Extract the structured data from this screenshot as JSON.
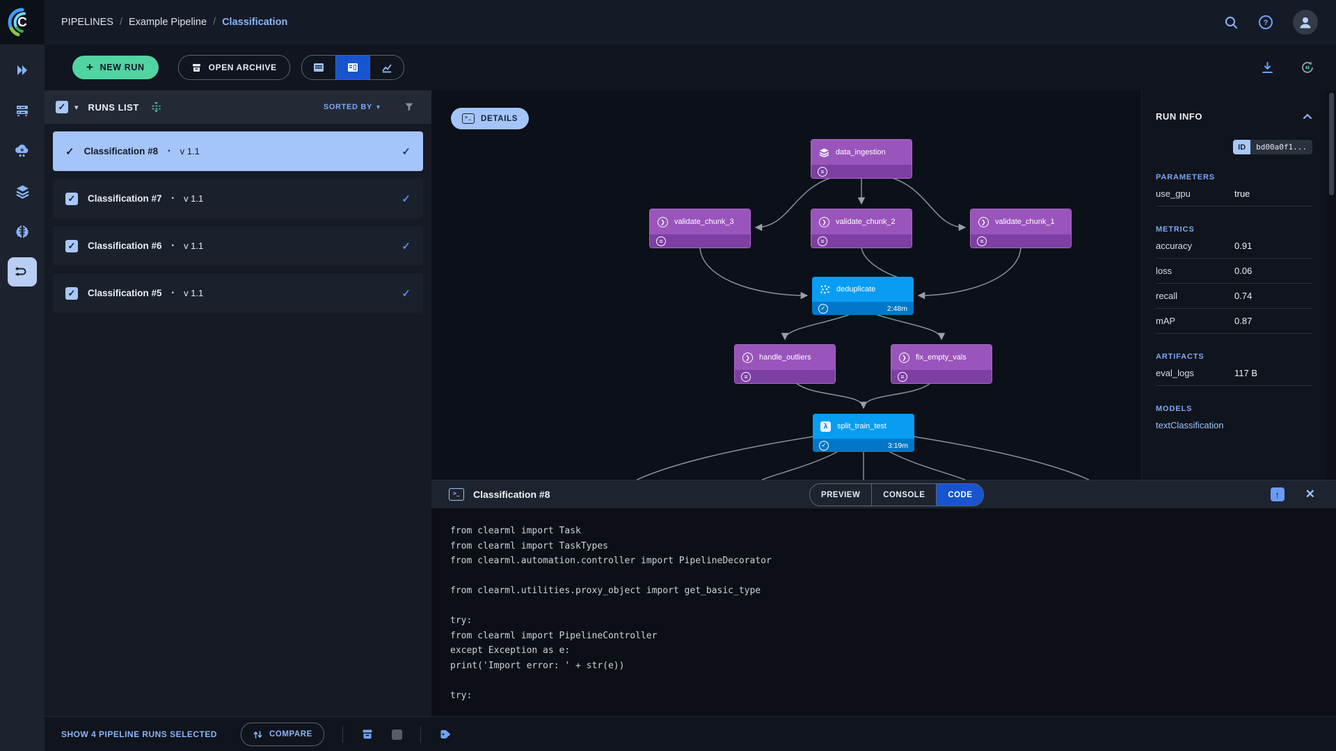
{
  "colors": {
    "accent_blue": "#1654d0",
    "light_blue": "#8ab4f8",
    "selection_bg": "#a5c4f9",
    "new_run_green": "#52d3a2",
    "node_purple": "#9a55bc",
    "node_purple_strip": "#7d3fa2",
    "node_blue": "#089df2",
    "node_blue_strip": "#0277c8"
  },
  "header": {
    "breadcrumb": {
      "root": "PIPELINES",
      "sep": "/",
      "project": "Example Pipeline",
      "current": "Classification"
    }
  },
  "toolbar": {
    "new_run_label": "NEW RUN",
    "open_archive_label": "OPEN ARCHIVE"
  },
  "runs_list": {
    "title": "RUNS LIST",
    "sorted_by_label": "SORTED BY",
    "items": [
      {
        "name": "Classification #8",
        "bullet": "•",
        "version": "v 1.1",
        "selected": true
      },
      {
        "name": "Classification #7",
        "bullet": "•",
        "version": "v 1.1",
        "selected": false
      },
      {
        "name": "Classification #6",
        "bullet": "•",
        "version": "v 1.1",
        "selected": false
      },
      {
        "name": "Classification #5",
        "bullet": "•",
        "version": "v 1.1",
        "selected": false
      }
    ],
    "check_glyph": "✓"
  },
  "dag": {
    "details_label": "DETAILS",
    "nodes": [
      {
        "label": "data_ingestion"
      },
      {
        "label": "validate_chunk_3"
      },
      {
        "label": "validate_chunk_2"
      },
      {
        "label": "validate_chunk_1"
      },
      {
        "label": "deduplicate",
        "duration": "2:48m"
      },
      {
        "label": "handle_outliers"
      },
      {
        "label": "fix_empty_vals"
      },
      {
        "label": "split_train_test",
        "duration": "3:19m"
      }
    ]
  },
  "run_info": {
    "title": "RUN INFO",
    "id_badge": "ID",
    "id_value": "bd00a0f1...",
    "parameters": {
      "title": "PARAMETERS",
      "rows": [
        {
          "k": "use_gpu",
          "v": "true"
        }
      ]
    },
    "metrics": {
      "title": "METRICS",
      "rows": [
        {
          "k": "accuracy",
          "v": "0.91"
        },
        {
          "k": "loss",
          "v": "0.06"
        },
        {
          "k": "recall",
          "v": "0.74"
        },
        {
          "k": "mAP",
          "v": "0.87"
        }
      ]
    },
    "artifacts": {
      "title": "ARTIFACTS",
      "rows": [
        {
          "k": "eval_logs",
          "v": "117 B"
        }
      ]
    },
    "models": {
      "title": "MODELS",
      "rows": [
        {
          "k": "textClassification",
          "v": ""
        }
      ]
    }
  },
  "bottom_panel": {
    "title": "Classification #8",
    "tabs": [
      "PREVIEW",
      "CONSOLE",
      "CODE"
    ],
    "active_tab": "CODE",
    "term_glyph": ">_",
    "code_lines": [
      "from clearml import Task",
      "from clearml import TaskTypes",
      "from clearml.automation.controller import PipelineDecorator",
      "",
      "from clearml.utilities.proxy_object import get_basic_type",
      "",
      "try:",
      "from clearml import PipelineController",
      "except Exception as e:",
      "print('Import error: ' + str(e))",
      "",
      "try:"
    ]
  },
  "footer": {
    "selection_text": "SHOW 4 PIPELINE RUNS SELECTED",
    "compare_label": "COMPARE"
  }
}
